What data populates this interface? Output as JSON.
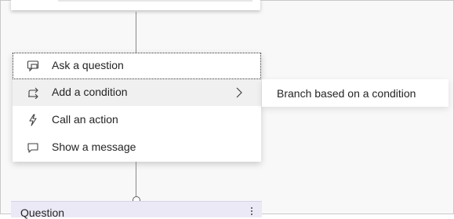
{
  "menu": {
    "items": [
      {
        "label": "Ask a question",
        "icon": "chat-question-icon"
      },
      {
        "label": "Add a condition",
        "icon": "branch-icon"
      },
      {
        "label": "Call an action",
        "icon": "lightning-icon"
      },
      {
        "label": "Show a message",
        "icon": "message-icon"
      }
    ]
  },
  "submenu": {
    "items": [
      {
        "label": "Branch based on a condition"
      }
    ]
  },
  "question_node": {
    "title": "Question",
    "menu_icon": "more-vertical-icon"
  }
}
